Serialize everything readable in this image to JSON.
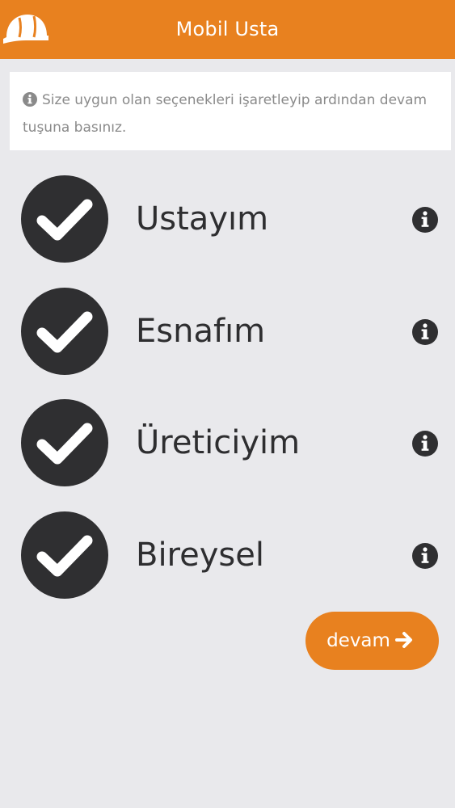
{
  "header": {
    "title": "Mobil Usta",
    "logo": "hard-hat-icon",
    "color": "#e8811f"
  },
  "notice": {
    "icon": "info-circle-icon",
    "text": "Size uygun olan seçenekleri işaretleyip ardından devam tuşuna basınız."
  },
  "options": [
    {
      "label": "Ustayım",
      "checked": true,
      "icon": "check-circle-icon",
      "info_icon": "info-icon"
    },
    {
      "label": "Esnafım",
      "checked": true,
      "icon": "check-circle-icon",
      "info_icon": "info-icon"
    },
    {
      "label": "Üreticiyim",
      "checked": true,
      "icon": "check-circle-icon",
      "info_icon": "info-icon"
    },
    {
      "label": "Bireysel",
      "checked": true,
      "icon": "check-circle-icon",
      "info_icon": "info-icon"
    }
  ],
  "continue_button": {
    "label": "devam",
    "icon": "arrow-right-icon"
  }
}
